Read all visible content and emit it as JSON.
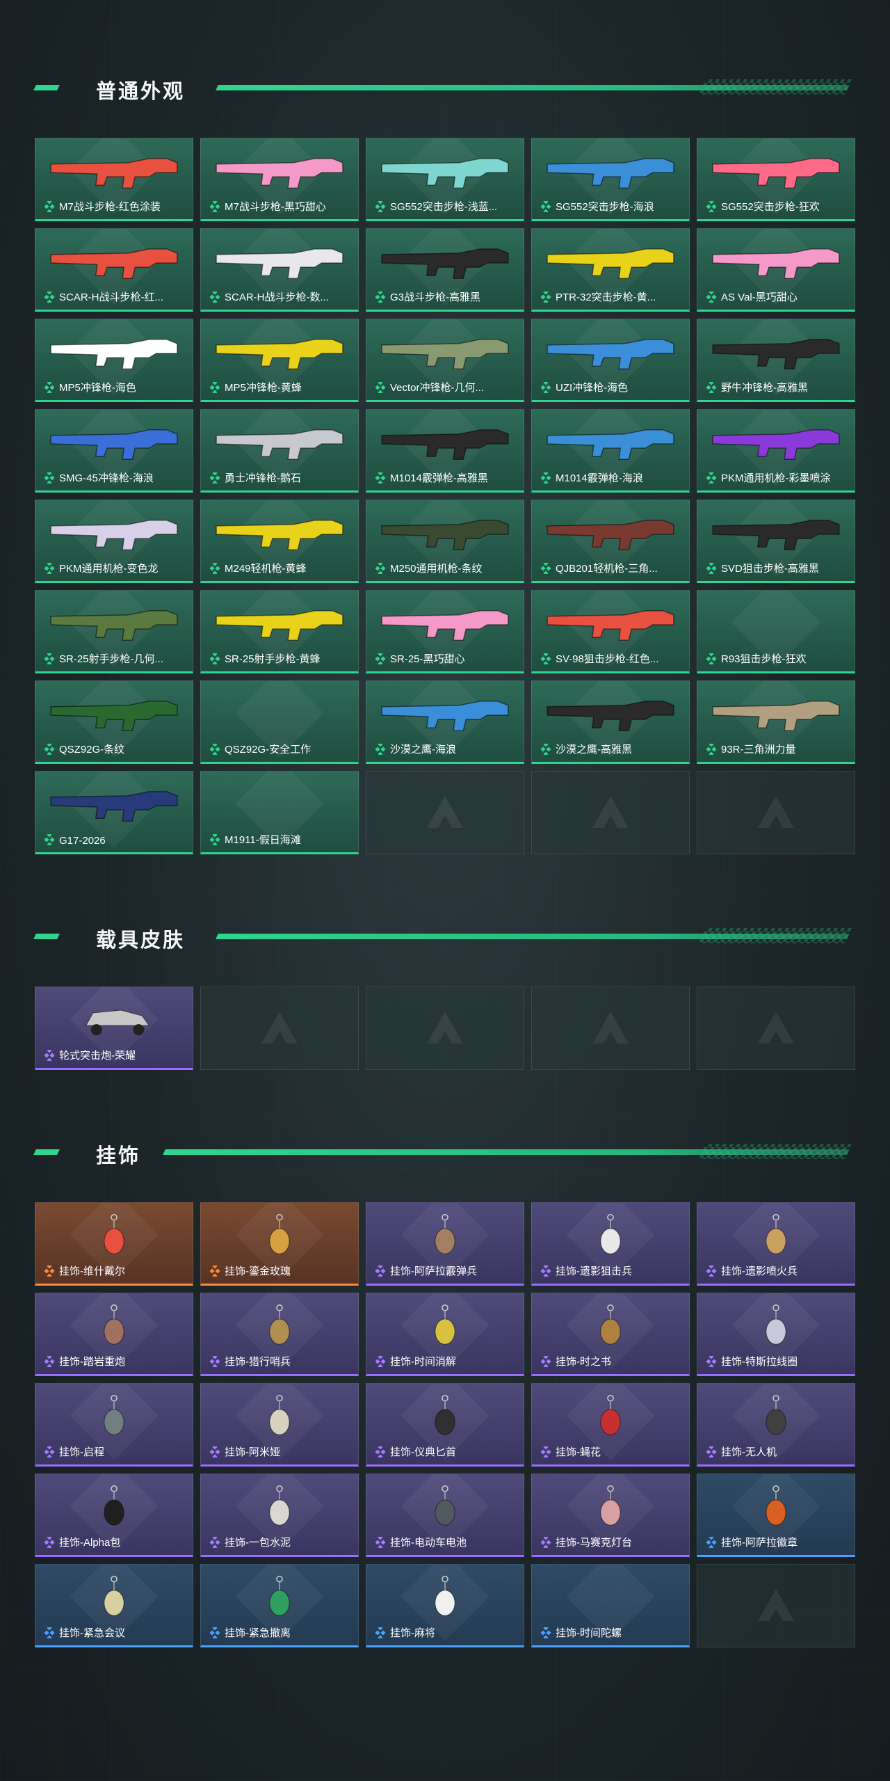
{
  "sections": {
    "skins": {
      "title": "普通外观",
      "items": [
        {
          "label": "M7战斗步枪-红色涂装",
          "color": "#e85040"
        },
        {
          "label": "M7战斗步枪-黑巧甜心",
          "color": "#f59ac8"
        },
        {
          "label": "SG552突击步枪-浅蓝...",
          "color": "#7fd6d0"
        },
        {
          "label": "SG552突击步枪-海浪",
          "color": "#3a8fd8"
        },
        {
          "label": "SG552突击步枪-狂欢",
          "color": "#ff6a88"
        },
        {
          "label": "SCAR-H战斗步枪-红...",
          "color": "#e85040"
        },
        {
          "label": "SCAR-H战斗步枪-数...",
          "color": "#e8e8ec"
        },
        {
          "label": "G3战斗步枪-高雅黑",
          "color": "#2a2a2a"
        },
        {
          "label": "PTR-32突击步枪-黄...",
          "color": "#e8d21a"
        },
        {
          "label": "AS Val-黑巧甜心",
          "color": "#f59ac8"
        },
        {
          "label": "MP5冲锋枪-海色",
          "color": "#ffffff"
        },
        {
          "label": "MP5冲锋枪-黄蜂",
          "color": "#e8d21a"
        },
        {
          "label": "Vector冲锋枪-几何...",
          "color": "#8a9a70"
        },
        {
          "label": "UZI冲锋枪-海色",
          "color": "#3a8fd8"
        },
        {
          "label": "野牛冲锋枪-高雅黑",
          "color": "#2a2a2a"
        },
        {
          "label": "SMG-45冲锋枪-海浪",
          "color": "#3a6fd8"
        },
        {
          "label": "勇士冲锋枪-鹅石",
          "color": "#c8c8d0"
        },
        {
          "label": "M1014霰弹枪-高雅黑",
          "color": "#2a2a2a"
        },
        {
          "label": "M1014霰弹枪-海浪",
          "color": "#3a8fd8"
        },
        {
          "label": "PKM通用机枪-彩墨喷涂",
          "color": "#8a3ad8"
        },
        {
          "label": "PKM通用机枪-变色龙",
          "color": "#d8d0e8"
        },
        {
          "label": "M249轻机枪-黄蜂",
          "color": "#e8d21a"
        },
        {
          "label": "M250通用机枪-条纹",
          "color": "#3a4a30"
        },
        {
          "label": "QJB201轻机枪-三角...",
          "color": "#7a3a30"
        },
        {
          "label": "SVD狙击步枪-高雅黑",
          "color": "#2a2a2a"
        },
        {
          "label": "SR-25射手步枪-几何...",
          "color": "#5a7a40"
        },
        {
          "label": "SR-25射手步枪-黄蜂",
          "color": "#e8d21a"
        },
        {
          "label": "SR-25-黑巧甜心",
          "color": "#f59ac8"
        },
        {
          "label": "SV-98狙击步枪-红色...",
          "color": "#e85040"
        },
        {
          "label": "R93狙击步枪-狂欢",
          "color": ""
        },
        {
          "label": "QSZ92G-条纹",
          "color": "#2a6a30"
        },
        {
          "label": "QSZ92G-安全工作",
          "color": ""
        },
        {
          "label": "沙漠之鹰-海浪",
          "color": "#3a8fd8"
        },
        {
          "label": "沙漠之鹰-高雅黑",
          "color": "#2a2a2a"
        },
        {
          "label": "93R-三角洲力量",
          "color": "#b0a080"
        },
        {
          "label": "G17-2026",
          "color": "#283a7a"
        },
        {
          "label": "M1911-假日海滩",
          "color": ""
        }
      ],
      "empty_count": 3
    },
    "vehicles": {
      "title": "载具皮肤",
      "items": [
        {
          "label": "轮式突击炮-荣耀",
          "color": "#c8c8c8"
        }
      ],
      "empty_count": 4
    },
    "charms": {
      "title": "挂饰",
      "items": [
        {
          "label": "挂饰-维什戴尔",
          "rarity": "orange",
          "color": "#e85040"
        },
        {
          "label": "挂饰-鎏金玫瑰",
          "rarity": "orange",
          "color": "#d8a040"
        },
        {
          "label": "挂饰-阿萨拉霰弹兵",
          "rarity": "purple",
          "color": "#a08060"
        },
        {
          "label": "挂饰-遗影狙击兵",
          "rarity": "purple",
          "color": "#e8e8e8"
        },
        {
          "label": "挂饰-遗影喷火兵",
          "rarity": "purple",
          "color": "#c8a060"
        },
        {
          "label": "挂饰-踏岩重炮",
          "rarity": "purple",
          "color": "#a07060"
        },
        {
          "label": "挂饰-猎行哨兵",
          "rarity": "purple",
          "color": "#b09050"
        },
        {
          "label": "挂饰-时间消解",
          "rarity": "purple",
          "color": "#d8c040"
        },
        {
          "label": "挂饰-时之书",
          "rarity": "purple",
          "color": "#b08040"
        },
        {
          "label": "挂饰-特斯拉线圈",
          "rarity": "purple",
          "color": "#c8c8d8"
        },
        {
          "label": "挂饰-启程",
          "rarity": "purple",
          "color": "#708080"
        },
        {
          "label": "挂饰-阿米娅",
          "rarity": "purple",
          "color": "#d8d0c0"
        },
        {
          "label": "挂饰-仪典匕首",
          "rarity": "purple",
          "color": "#303030"
        },
        {
          "label": "挂饰-蝇花",
          "rarity": "purple",
          "color": "#c83030"
        },
        {
          "label": "挂饰-无人机",
          "rarity": "purple",
          "color": "#404040"
        },
        {
          "label": "挂饰-Alpha包",
          "rarity": "purple",
          "color": "#202020"
        },
        {
          "label": "挂饰-一包水泥",
          "rarity": "purple",
          "color": "#d8d8d0"
        },
        {
          "label": "挂饰-电动车电池",
          "rarity": "purple",
          "color": "#505860"
        },
        {
          "label": "挂饰-马赛克灯台",
          "rarity": "purple",
          "color": "#d8a0a0"
        },
        {
          "label": "挂饰-阿萨拉徽章",
          "rarity": "blue",
          "color": "#d86020"
        },
        {
          "label": "挂饰-紧急会议",
          "rarity": "blue",
          "color": "#d8d0a0"
        },
        {
          "label": "挂饰-紧急撤离",
          "rarity": "blue",
          "color": "#30a060"
        },
        {
          "label": "挂饰-麻将",
          "rarity": "blue",
          "color": "#f0f0f0"
        },
        {
          "label": "挂饰-时间陀螺",
          "rarity": "blue",
          "color": ""
        }
      ],
      "empty_count": 1
    }
  },
  "accent": "#2fd58f"
}
